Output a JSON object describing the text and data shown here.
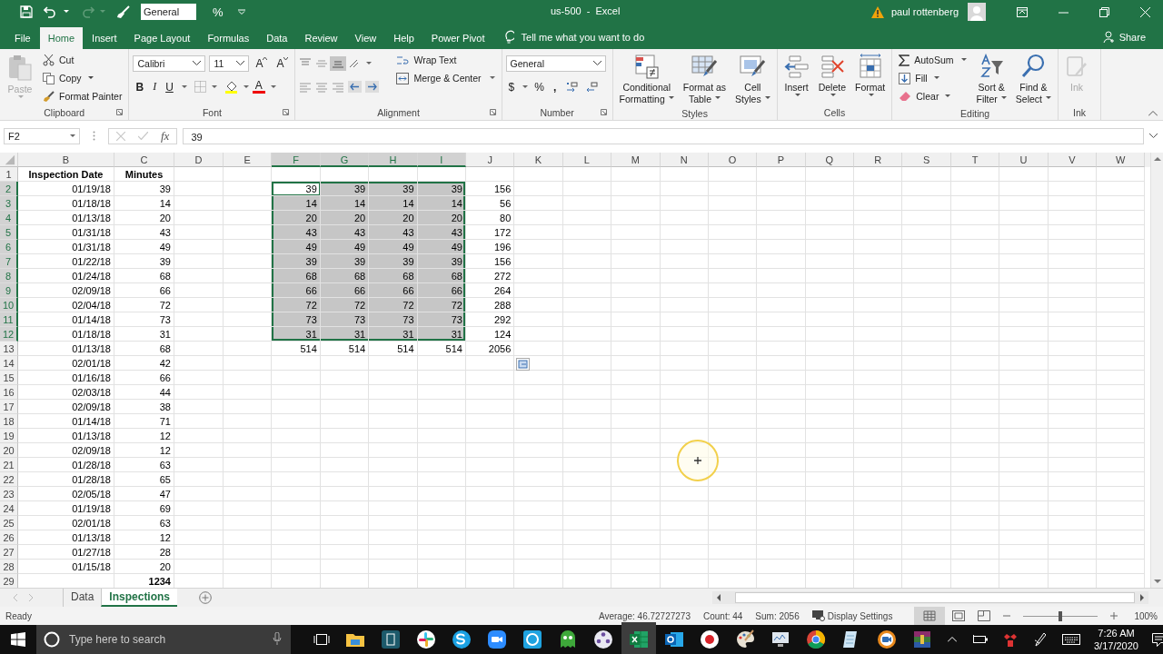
{
  "title_bar": {
    "number_format": "General",
    "percent": "%",
    "title": "us-500  -  Excel",
    "user": "paul rottenberg"
  },
  "menu_tabs": [
    {
      "label": "File",
      "selected": false
    },
    {
      "label": "Home",
      "selected": true
    },
    {
      "label": "Insert",
      "selected": false
    },
    {
      "label": "Page Layout",
      "selected": false
    },
    {
      "label": "Formulas",
      "selected": false
    },
    {
      "label": "Data",
      "selected": false
    },
    {
      "label": "Review",
      "selected": false
    },
    {
      "label": "View",
      "selected": false
    },
    {
      "label": "Help",
      "selected": false
    },
    {
      "label": "Power Pivot",
      "selected": false
    }
  ],
  "tell_me": "Tell me what you want to do",
  "share": "Share",
  "ribbon": {
    "clipboard": {
      "label": "Clipboard",
      "paste": "Paste",
      "cut": "Cut",
      "copy": "Copy",
      "format_painter": "Format Painter"
    },
    "font": {
      "label": "Font",
      "name": "Calibri",
      "size": "11",
      "grow": "A",
      "shrink": "A",
      "bold": "B",
      "italic": "I",
      "underline": "U",
      "font_color": "A"
    },
    "alignment": {
      "label": "Alignment",
      "wrap_text": "Wrap Text",
      "merge": "Merge & Center"
    },
    "number": {
      "label": "Number",
      "format": "General",
      "currency": "$",
      "percent": "%",
      "comma": ","
    },
    "styles": {
      "label": "Styles",
      "conditional": [
        "Conditional",
        "Formatting"
      ],
      "format_table": [
        "Format as",
        "Table"
      ],
      "cell_styles": [
        "Cell",
        "Styles"
      ]
    },
    "cells": {
      "label": "Cells",
      "insert": "Insert",
      "delete": "Delete",
      "format": "Format"
    },
    "editing": {
      "label": "Editing",
      "autosum": "AutoSum",
      "fill": "Fill",
      "clear": "Clear",
      "sort": [
        "Sort &",
        "Filter"
      ],
      "find": [
        "Find &",
        "Select"
      ]
    },
    "ink": {
      "label": "Ink",
      "ink": "Ink",
      "disabled": true
    }
  },
  "formula_bar": {
    "name_box": "F2",
    "fx": "fx",
    "value": "39"
  },
  "sheet": {
    "columns": [
      {
        "label": "B",
        "selected": false
      },
      {
        "label": "C",
        "selected": false
      },
      {
        "label": "D",
        "selected": false
      },
      {
        "label": "E",
        "selected": false
      },
      {
        "label": "F",
        "selected": true
      },
      {
        "label": "G",
        "selected": true
      },
      {
        "label": "H",
        "selected": true
      },
      {
        "label": "I",
        "selected": true
      },
      {
        "label": "J",
        "selected": false
      },
      {
        "label": "K",
        "selected": false
      },
      {
        "label": "L",
        "selected": false
      },
      {
        "label": "M",
        "selected": false
      },
      {
        "label": "N",
        "selected": false
      },
      {
        "label": "O",
        "selected": false
      },
      {
        "label": "P",
        "selected": false
      },
      {
        "label": "Q",
        "selected": false
      },
      {
        "label": "R",
        "selected": false
      },
      {
        "label": "S",
        "selected": false
      },
      {
        "label": "T",
        "selected": false
      },
      {
        "label": "U",
        "selected": false
      },
      {
        "label": "V",
        "selected": false
      },
      {
        "label": "W",
        "selected": false
      }
    ],
    "rows": [
      {
        "number": "1",
        "kind": "header",
        "selected": false,
        "cells": {
          "b": {
            "text": "Inspection Date",
            "selected": false,
            "active": false
          },
          "c": {
            "text": "Minutes",
            "selected": false,
            "active": false
          }
        }
      },
      {
        "number": "2",
        "kind": "data",
        "selected": true,
        "cells": {
          "b": {
            "text": "01/19/18",
            "selected": false,
            "active": false
          },
          "c": {
            "text": "39",
            "selected": false,
            "active": false
          },
          "f": {
            "text": "39",
            "selected": true,
            "active": true
          },
          "g": {
            "text": "39",
            "selected": true,
            "active": false
          },
          "h": {
            "text": "39",
            "selected": true,
            "active": false
          },
          "i": {
            "text": "39",
            "selected": true,
            "active": false
          },
          "j": {
            "text": "156",
            "selected": false,
            "active": false
          }
        }
      },
      {
        "number": "3",
        "kind": "data",
        "selected": true,
        "cells": {
          "b": {
            "text": "01/18/18",
            "selected": false,
            "active": false
          },
          "c": {
            "text": "14",
            "selected": false,
            "active": false
          },
          "f": {
            "text": "14",
            "selected": true,
            "active": false
          },
          "g": {
            "text": "14",
            "selected": true,
            "active": false
          },
          "h": {
            "text": "14",
            "selected": true,
            "active": false
          },
          "i": {
            "text": "14",
            "selected": true,
            "active": false
          },
          "j": {
            "text": "56",
            "selected": false,
            "active": false
          }
        }
      },
      {
        "number": "4",
        "kind": "data",
        "selected": true,
        "cells": {
          "b": {
            "text": "01/13/18",
            "selected": false,
            "active": false
          },
          "c": {
            "text": "20",
            "selected": false,
            "active": false
          },
          "f": {
            "text": "20",
            "selected": true,
            "active": false
          },
          "g": {
            "text": "20",
            "selected": true,
            "active": false
          },
          "h": {
            "text": "20",
            "selected": true,
            "active": false
          },
          "i": {
            "text": "20",
            "selected": true,
            "active": false
          },
          "j": {
            "text": "80",
            "selected": false,
            "active": false
          }
        }
      },
      {
        "number": "5",
        "kind": "data",
        "selected": true,
        "cells": {
          "b": {
            "text": "01/31/18",
            "selected": false,
            "active": false
          },
          "c": {
            "text": "43",
            "selected": false,
            "active": false
          },
          "f": {
            "text": "43",
            "selected": true,
            "active": false
          },
          "g": {
            "text": "43",
            "selected": true,
            "active": false
          },
          "h": {
            "text": "43",
            "selected": true,
            "active": false
          },
          "i": {
            "text": "43",
            "selected": true,
            "active": false
          },
          "j": {
            "text": "172",
            "selected": false,
            "active": false
          }
        }
      },
      {
        "number": "6",
        "kind": "data",
        "selected": true,
        "cells": {
          "b": {
            "text": "01/31/18",
            "selected": false,
            "active": false
          },
          "c": {
            "text": "49",
            "selected": false,
            "active": false
          },
          "f": {
            "text": "49",
            "selected": true,
            "active": false
          },
          "g": {
            "text": "49",
            "selected": true,
            "active": false
          },
          "h": {
            "text": "49",
            "selected": true,
            "active": false
          },
          "i": {
            "text": "49",
            "selected": true,
            "active": false
          },
          "j": {
            "text": "196",
            "selected": false,
            "active": false
          }
        }
      },
      {
        "number": "7",
        "kind": "data",
        "selected": true,
        "cells": {
          "b": {
            "text": "01/22/18",
            "selected": false,
            "active": false
          },
          "c": {
            "text": "39",
            "selected": false,
            "active": false
          },
          "f": {
            "text": "39",
            "selected": true,
            "active": false
          },
          "g": {
            "text": "39",
            "selected": true,
            "active": false
          },
          "h": {
            "text": "39",
            "selected": true,
            "active": false
          },
          "i": {
            "text": "39",
            "selected": true,
            "active": false
          },
          "j": {
            "text": "156",
            "selected": false,
            "active": false
          }
        }
      },
      {
        "number": "8",
        "kind": "data",
        "selected": true,
        "cells": {
          "b": {
            "text": "01/24/18",
            "selected": false,
            "active": false
          },
          "c": {
            "text": "68",
            "selected": false,
            "active": false
          },
          "f": {
            "text": "68",
            "selected": true,
            "active": false
          },
          "g": {
            "text": "68",
            "selected": true,
            "active": false
          },
          "h": {
            "text": "68",
            "selected": true,
            "active": false
          },
          "i": {
            "text": "68",
            "selected": true,
            "active": false
          },
          "j": {
            "text": "272",
            "selected": false,
            "active": false
          }
        }
      },
      {
        "number": "9",
        "kind": "data",
        "selected": true,
        "cells": {
          "b": {
            "text": "02/09/18",
            "selected": false,
            "active": false
          },
          "c": {
            "text": "66",
            "selected": false,
            "active": false
          },
          "f": {
            "text": "66",
            "selected": true,
            "active": false
          },
          "g": {
            "text": "66",
            "selected": true,
            "active": false
          },
          "h": {
            "text": "66",
            "selected": true,
            "active": false
          },
          "i": {
            "text": "66",
            "selected": true,
            "active": false
          },
          "j": {
            "text": "264",
            "selected": false,
            "active": false
          }
        }
      },
      {
        "number": "10",
        "kind": "data",
        "selected": true,
        "cells": {
          "b": {
            "text": "02/04/18",
            "selected": false,
            "active": false
          },
          "c": {
            "text": "72",
            "selected": false,
            "active": false
          },
          "f": {
            "text": "72",
            "selected": true,
            "active": false
          },
          "g": {
            "text": "72",
            "selected": true,
            "active": false
          },
          "h": {
            "text": "72",
            "selected": true,
            "active": false
          },
          "i": {
            "text": "72",
            "selected": true,
            "active": false
          },
          "j": {
            "text": "288",
            "selected": false,
            "active": false
          }
        }
      },
      {
        "number": "11",
        "kind": "data",
        "selected": true,
        "cells": {
          "b": {
            "text": "01/14/18",
            "selected": false,
            "active": false
          },
          "c": {
            "text": "73",
            "selected": false,
            "active": false
          },
          "f": {
            "text": "73",
            "selected": true,
            "active": false
          },
          "g": {
            "text": "73",
            "selected": true,
            "active": false
          },
          "h": {
            "text": "73",
            "selected": true,
            "active": false
          },
          "i": {
            "text": "73",
            "selected": true,
            "active": false
          },
          "j": {
            "text": "292",
            "selected": false,
            "active": false
          }
        }
      },
      {
        "number": "12",
        "kind": "data",
        "selected": true,
        "cells": {
          "b": {
            "text": "01/18/18",
            "selected": false,
            "active": false
          },
          "c": {
            "text": "31",
            "selected": false,
            "active": false
          },
          "f": {
            "text": "31",
            "selected": true,
            "active": false
          },
          "g": {
            "text": "31",
            "selected": true,
            "active": false
          },
          "h": {
            "text": "31",
            "selected": true,
            "active": false
          },
          "i": {
            "text": "31",
            "selected": true,
            "active": false
          },
          "j": {
            "text": "124",
            "selected": false,
            "active": false
          }
        }
      },
      {
        "number": "13",
        "kind": "data",
        "selected": false,
        "cells": {
          "b": {
            "text": "01/13/18",
            "selected": false,
            "active": false
          },
          "c": {
            "text": "68",
            "selected": false,
            "active": false
          },
          "f": {
            "text": "514",
            "selected": false,
            "active": false
          },
          "g": {
            "text": "514",
            "selected": false,
            "active": false
          },
          "h": {
            "text": "514",
            "selected": false,
            "active": false
          },
          "i": {
            "text": "514",
            "selected": false,
            "active": false
          },
          "j": {
            "text": "2056",
            "selected": false,
            "active": false
          }
        }
      },
      {
        "number": "14",
        "kind": "data",
        "selected": false,
        "cells": {
          "b": {
            "text": "02/01/18",
            "selected": false,
            "active": false
          },
          "c": {
            "text": "42",
            "selected": false,
            "active": false
          }
        }
      },
      {
        "number": "15",
        "kind": "data",
        "selected": false,
        "cells": {
          "b": {
            "text": "01/16/18",
            "selected": false,
            "active": false
          },
          "c": {
            "text": "66",
            "selected": false,
            "active": false
          }
        }
      },
      {
        "number": "16",
        "kind": "data",
        "selected": false,
        "cells": {
          "b": {
            "text": "02/03/18",
            "selected": false,
            "active": false
          },
          "c": {
            "text": "44",
            "selected": false,
            "active": false
          }
        }
      },
      {
        "number": "17",
        "kind": "data",
        "selected": false,
        "cells": {
          "b": {
            "text": "02/09/18",
            "selected": false,
            "active": false
          },
          "c": {
            "text": "38",
            "selected": false,
            "active": false
          }
        }
      },
      {
        "number": "18",
        "kind": "data",
        "selected": false,
        "cells": {
          "b": {
            "text": "01/14/18",
            "selected": false,
            "active": false
          },
          "c": {
            "text": "71",
            "selected": false,
            "active": false
          }
        }
      },
      {
        "number": "19",
        "kind": "data",
        "selected": false,
        "cells": {
          "b": {
            "text": "01/13/18",
            "selected": false,
            "active": false
          },
          "c": {
            "text": "12",
            "selected": false,
            "active": false
          }
        }
      },
      {
        "number": "20",
        "kind": "data",
        "selected": false,
        "cells": {
          "b": {
            "text": "02/09/18",
            "selected": false,
            "active": false
          },
          "c": {
            "text": "12",
            "selected": false,
            "active": false
          }
        }
      },
      {
        "number": "21",
        "kind": "data",
        "selected": false,
        "cells": {
          "b": {
            "text": "01/28/18",
            "selected": false,
            "active": false
          },
          "c": {
            "text": "63",
            "selected": false,
            "active": false
          }
        }
      },
      {
        "number": "22",
        "kind": "data",
        "selected": false,
        "cells": {
          "b": {
            "text": "01/28/18",
            "selected": false,
            "active": false
          },
          "c": {
            "text": "65",
            "selected": false,
            "active": false
          }
        }
      },
      {
        "number": "23",
        "kind": "data",
        "selected": false,
        "cells": {
          "b": {
            "text": "02/05/18",
            "selected": false,
            "active": false
          },
          "c": {
            "text": "47",
            "selected": false,
            "active": false
          }
        }
      },
      {
        "number": "24",
        "kind": "data",
        "selected": false,
        "cells": {
          "b": {
            "text": "01/19/18",
            "selected": false,
            "active": false
          },
          "c": {
            "text": "69",
            "selected": false,
            "active": false
          }
        }
      },
      {
        "number": "25",
        "kind": "data",
        "selected": false,
        "cells": {
          "b": {
            "text": "02/01/18",
            "selected": false,
            "active": false
          },
          "c": {
            "text": "63",
            "selected": false,
            "active": false
          }
        }
      },
      {
        "number": "26",
        "kind": "data",
        "selected": false,
        "cells": {
          "b": {
            "text": "01/13/18",
            "selected": false,
            "active": false
          },
          "c": {
            "text": "12",
            "selected": false,
            "active": false
          }
        }
      },
      {
        "number": "27",
        "kind": "data",
        "selected": false,
        "cells": {
          "b": {
            "text": "01/27/18",
            "selected": false,
            "active": false
          },
          "c": {
            "text": "28",
            "selected": false,
            "active": false
          }
        }
      },
      {
        "number": "28",
        "kind": "data",
        "selected": false,
        "cells": {
          "b": {
            "text": "01/15/18",
            "selected": false,
            "active": false
          },
          "c": {
            "text": "20",
            "selected": false,
            "active": false
          }
        }
      },
      {
        "number": "29",
        "kind": "total",
        "selected": false,
        "cells": {
          "c": {
            "text": "1234",
            "selected": false,
            "active": false
          }
        }
      }
    ]
  },
  "sheet_tabs": [
    {
      "label": "Data",
      "selected": false
    },
    {
      "label": "Inspections",
      "selected": true
    }
  ],
  "status_bar": {
    "mode": "Ready",
    "average": "Average: 46.72727273",
    "count": "Count: 44",
    "sum": "Sum: 2056",
    "display_settings": "Display Settings",
    "level": 0.5,
    "zoom": "100%"
  },
  "taskbar": {
    "search_placeholder": "Type here to search",
    "time": "7:26 AM",
    "date": "3/17/2020"
  }
}
